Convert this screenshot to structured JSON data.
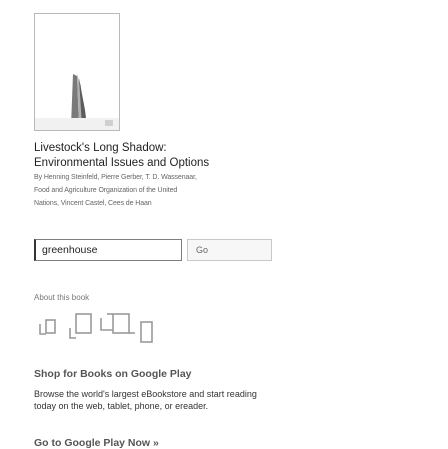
{
  "book": {
    "title_line1": "Livestock's Long Shadow:",
    "title_line2": "Environmental Issues and Options",
    "authors_line1": "By Henning Steinfeld, Pierre Gerber, T. D. Wassenaar,",
    "authors_line2": "Food and Agriculture Organization of the United",
    "authors_line3": "Nations, Vincent Castel, Cees de Haan"
  },
  "search": {
    "value": "greenhouse",
    "go_label": "Go"
  },
  "about_link": "About this book",
  "promo": {
    "shop_title": "Shop for Books on Google Play",
    "browse_text": "Browse the world's largest eBookstore and start reading today on the web, tablet, phone, or ereader.",
    "go_link": "Go to Google Play Now »"
  }
}
